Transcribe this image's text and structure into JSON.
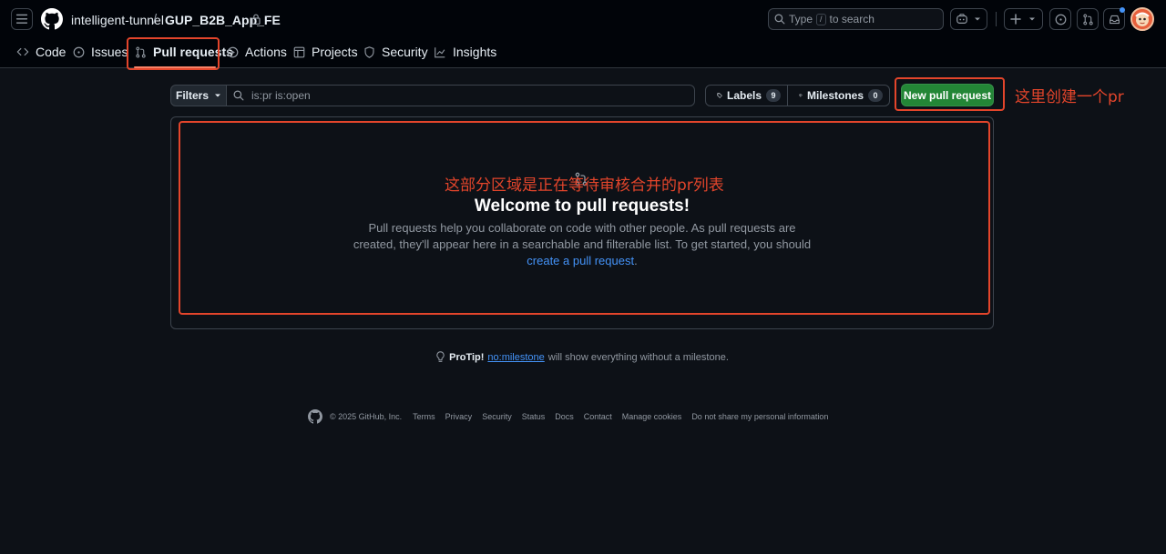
{
  "header": {
    "owner": "intelligent-tunnel",
    "separator": "/",
    "repo": "GUP_B2B_App_FE",
    "search_placeholder_prefix": "Type",
    "search_key": "/",
    "search_placeholder_suffix": "to search"
  },
  "nav": {
    "tabs": [
      {
        "label": "Code",
        "icon": "code-icon"
      },
      {
        "label": "Issues",
        "icon": "issue-opened-icon"
      },
      {
        "label": "Pull requests",
        "icon": "git-pull-request-icon",
        "active": true
      },
      {
        "label": "Actions",
        "icon": "play-icon"
      },
      {
        "label": "Projects",
        "icon": "table-icon"
      },
      {
        "label": "Security",
        "icon": "shield-icon"
      },
      {
        "label": "Insights",
        "icon": "graph-icon"
      }
    ]
  },
  "toolbar": {
    "filters_label": "Filters",
    "filter_query": "is:pr is:open",
    "labels_label": "Labels",
    "labels_count": "9",
    "milestones_label": "Milestones",
    "milestones_count": "0",
    "new_pr_label": "New pull request"
  },
  "blankslate": {
    "title": "Welcome to pull requests!",
    "body": "Pull requests help you collaborate on code with other people. As pull requests are created, they'll appear here in a searchable and filterable list. To get started, you should",
    "link": "create a pull request",
    "end": "."
  },
  "protip": {
    "label": "ProTip!",
    "link": "no:milestone",
    "text": "will show everything without a milestone."
  },
  "footer": {
    "copyright": "© 2025 GitHub, Inc.",
    "links": [
      "Terms",
      "Privacy",
      "Security",
      "Status",
      "Docs",
      "Contact",
      "Manage cookies",
      "Do not share my personal information"
    ]
  },
  "annotations": {
    "new_pr_note": "这里创建一个pr",
    "list_note": "这部分区域是正在等待审核合并的pr列表"
  },
  "colors": {
    "background": "#0d1117",
    "header": "#010409",
    "accent_green": "#238636",
    "link_blue": "#4493f8",
    "tab_underline": "#f78166",
    "annotation_red": "#e3452b"
  }
}
